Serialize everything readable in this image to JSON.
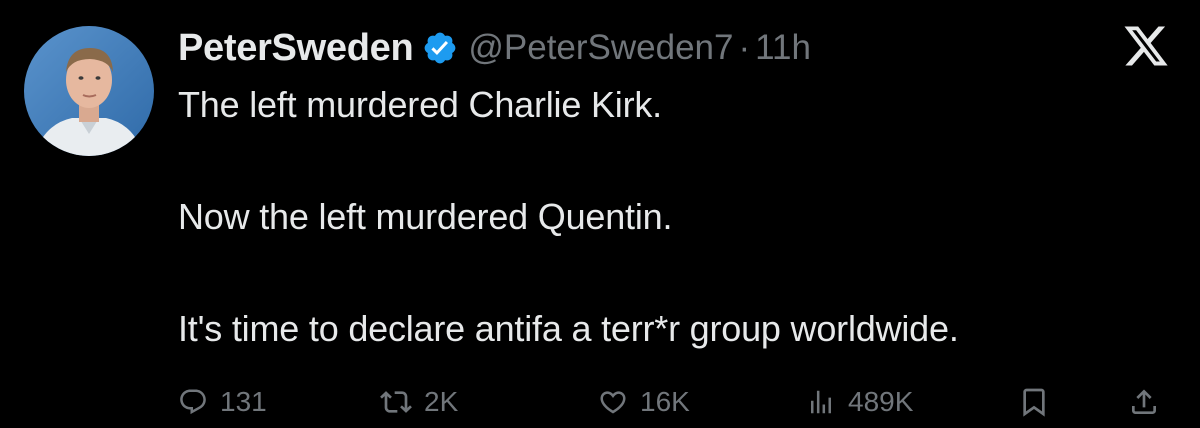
{
  "tweet": {
    "display_name": "PeterSweden",
    "handle": "@PeterSweden7",
    "separator": "·",
    "time": "11h",
    "lines": [
      "The left murdered Charlie Kirk.",
      "Now the left murdered Quentin.",
      "It's time to declare antifa a terr*r group worldwide."
    ]
  },
  "metrics": {
    "replies": "131",
    "reposts": "2K",
    "likes": "16K",
    "views": "489K"
  },
  "icons": {
    "verified": "verified-badge-icon",
    "brand": "x-logo-icon",
    "reply": "reply-icon",
    "repost": "repost-icon",
    "like": "heart-icon",
    "views": "views-icon",
    "bookmark": "bookmark-icon",
    "share": "share-icon"
  },
  "colors": {
    "background": "#000000",
    "text_primary": "#e7e9ea",
    "text_secondary": "#71767b",
    "verified_blue": "#1d9bf0"
  }
}
